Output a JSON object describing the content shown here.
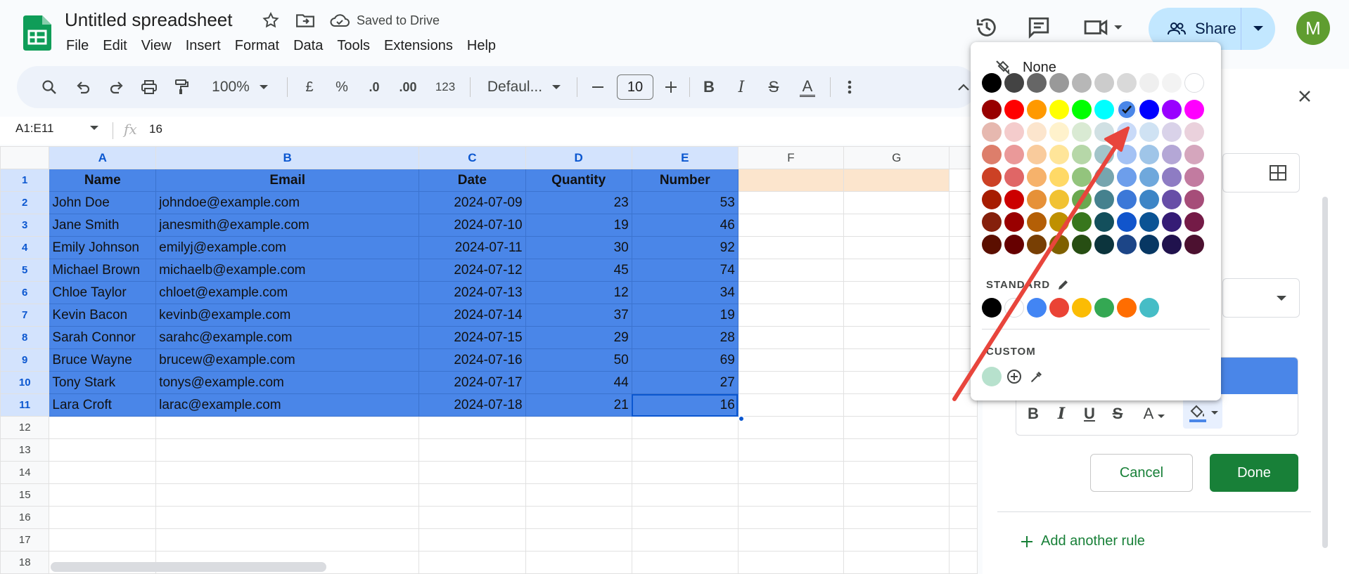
{
  "header": {
    "title": "Untitled spreadsheet",
    "saved_status": "Saved to Drive",
    "share_label": "Share",
    "avatar_letter": "M"
  },
  "menu": [
    "File",
    "Edit",
    "View",
    "Insert",
    "Format",
    "Data",
    "Tools",
    "Extensions",
    "Help"
  ],
  "toolbar": {
    "zoom": "100%",
    "currency": "£",
    "percent": "%",
    "dec_decrease": ".0",
    "dec_increase": ".00",
    "number_format": "123",
    "font": "Defaul...",
    "font_size": "10"
  },
  "formula_bar": {
    "range": "A1:E11",
    "fx": "fx",
    "value": "16"
  },
  "grid": {
    "columns": [
      "A",
      "B",
      "C",
      "D",
      "E",
      "F",
      "G"
    ],
    "header_row": [
      "Name",
      "Email",
      "Date",
      "Quantity",
      "Number"
    ],
    "rows": [
      [
        "John Doe",
        "johndoe@example.com",
        "2024-07-09",
        "23",
        "53"
      ],
      [
        "Jane Smith",
        "janesmith@example.com",
        "2024-07-10",
        "19",
        "46"
      ],
      [
        "Emily Johnson",
        "emilyj@example.com",
        "2024-07-11",
        "30",
        "92"
      ],
      [
        "Michael Brown",
        "michaelb@example.com",
        "2024-07-12",
        "45",
        "74"
      ],
      [
        "Chloe Taylor",
        "chloet@example.com",
        "2024-07-13",
        "12",
        "34"
      ],
      [
        "Kevin Bacon",
        "kevinb@example.com",
        "2024-07-14",
        "37",
        "19"
      ],
      [
        "Sarah Connor",
        "sarahc@example.com",
        "2024-07-15",
        "29",
        "28"
      ],
      [
        "Bruce Wayne",
        "brucew@example.com",
        "2024-07-16",
        "50",
        "69"
      ],
      [
        "Tony Stark",
        "tonys@example.com",
        "2024-07-17",
        "44",
        "27"
      ],
      [
        "Lara Croft",
        "larac@example.com",
        "2024-07-18",
        "21",
        "16"
      ]
    ],
    "row_numbers": [
      "1",
      "2",
      "3",
      "4",
      "5",
      "6",
      "7",
      "8",
      "9",
      "10",
      "11",
      "12",
      "13",
      "14",
      "15",
      "16",
      "17",
      "18"
    ]
  },
  "palette": {
    "none_label": "None",
    "standard_label": "STANDARD",
    "custom_label": "CUSTOM",
    "selected_color": "#4a86e8",
    "rows": [
      [
        "#000000",
        "#434343",
        "#666666",
        "#999999",
        "#b7b7b7",
        "#cccccc",
        "#d9d9d9",
        "#efefef",
        "#f3f3f3",
        "#ffffff"
      ],
      [
        "#980000",
        "#ff0000",
        "#ff9900",
        "#ffff00",
        "#00ff00",
        "#00ffff",
        "#4a86e8",
        "#0000ff",
        "#9900ff",
        "#ff00ff"
      ],
      [
        "#e6b8af",
        "#f4cccc",
        "#fce5cd",
        "#fff2cc",
        "#d9ead3",
        "#d0e0e3",
        "#c9daf8",
        "#cfe2f3",
        "#d9d2e9",
        "#ead1dc"
      ],
      [
        "#dd7e6b",
        "#ea9999",
        "#f9cb9c",
        "#ffe599",
        "#b6d7a8",
        "#a2c4c9",
        "#a4c2f4",
        "#9fc5e8",
        "#b4a7d6",
        "#d5a6bd"
      ],
      [
        "#cc4125",
        "#e06666",
        "#f6b26b",
        "#ffd966",
        "#93c47d",
        "#76a5af",
        "#6d9eeb",
        "#6fa8dc",
        "#8e7cc3",
        "#c27ba0"
      ],
      [
        "#a61c00",
        "#cc0000",
        "#e69138",
        "#f1c232",
        "#6aa84f",
        "#45818e",
        "#3c78d8",
        "#3d85c6",
        "#674ea7",
        "#a64d79"
      ],
      [
        "#85200c",
        "#990000",
        "#b45f06",
        "#bf9000",
        "#38761d",
        "#134f5c",
        "#1155cc",
        "#0b5394",
        "#351c75",
        "#741b47"
      ],
      [
        "#5b0f00",
        "#660000",
        "#783f04",
        "#7f6000",
        "#274e13",
        "#0c343d",
        "#1c4587",
        "#073763",
        "#20124d",
        "#4c1130"
      ]
    ],
    "standard": [
      "#000000",
      "#ffffff",
      "#4285f4",
      "#ea4335",
      "#fbbc04",
      "#34a853",
      "#ff6d01",
      "#46bdc6"
    ],
    "custom": [
      "#b7e1cd"
    ]
  },
  "side_panel": {
    "cancel_label": "Cancel",
    "done_label": "Done",
    "add_rule_label": "Add another rule"
  },
  "colors": {
    "accent_green": "#188038",
    "selection_blue": "#4a86e8",
    "annotation_arrow": "#e8453c"
  }
}
